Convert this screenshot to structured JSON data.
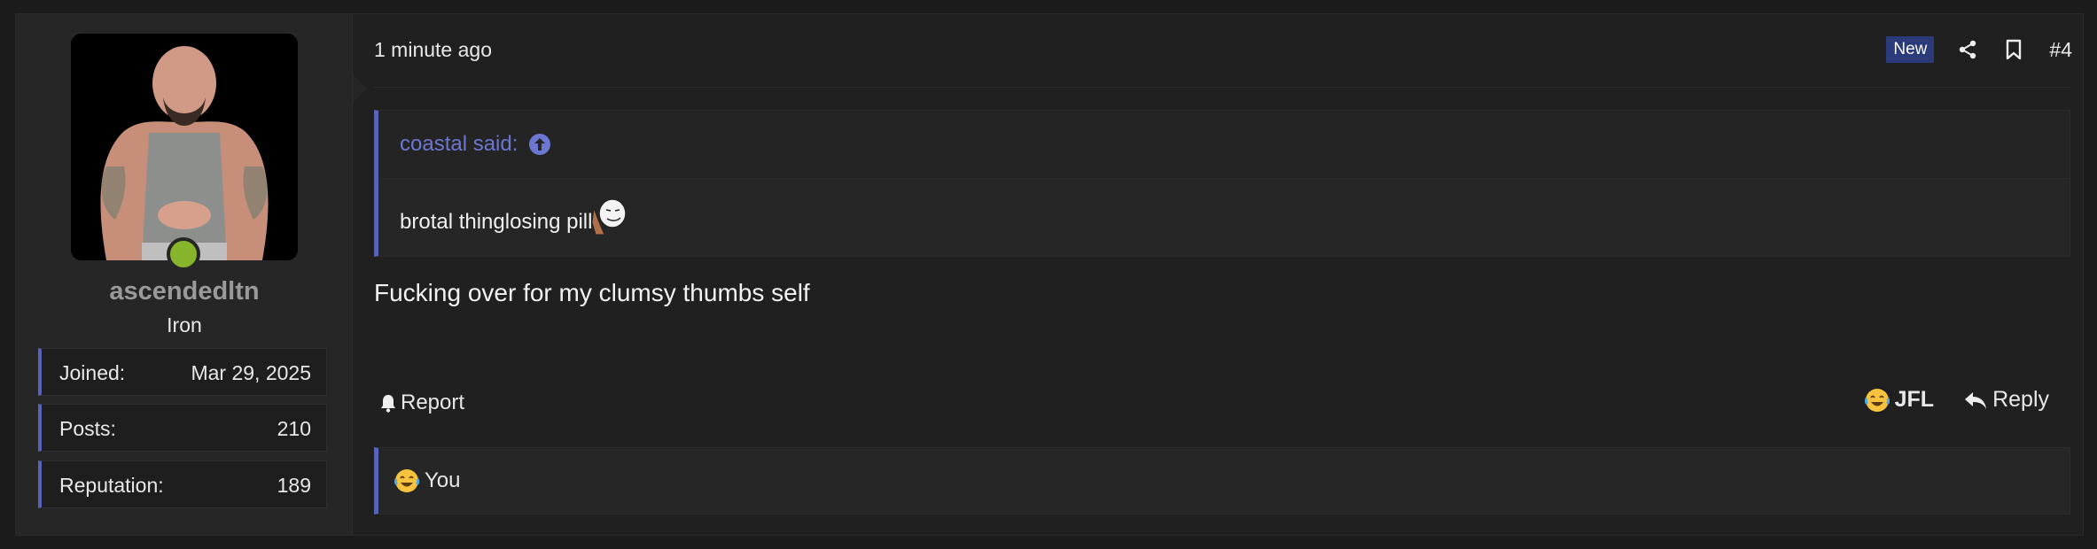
{
  "user": {
    "avatar_icon": "user-avatar-photo",
    "online_color": "#86b52b",
    "username": "ascendedltn",
    "rank": "Iron",
    "stats": [
      {
        "key": "Joined:",
        "value": "Mar 29, 2025"
      },
      {
        "key": "Posts:",
        "value": "210"
      },
      {
        "key": "Reputation:",
        "value": "189"
      }
    ]
  },
  "post": {
    "time": "1 minute ago",
    "badge": "New",
    "number": "#4",
    "quote": {
      "author": "coastal said:",
      "text": "brotal thinglosing pill",
      "emoji_icon": "smug-face-emoji-icon"
    },
    "message": "Fucking over for my clumsy thumbs self",
    "report_label": "Report",
    "jfl_label": "JFL",
    "reply_label": "Reply",
    "reactions_text": "You"
  },
  "colors": {
    "accent": "#5863b9",
    "quote_author": "#6b77d1",
    "badge_bg": "#2a3a7a"
  }
}
